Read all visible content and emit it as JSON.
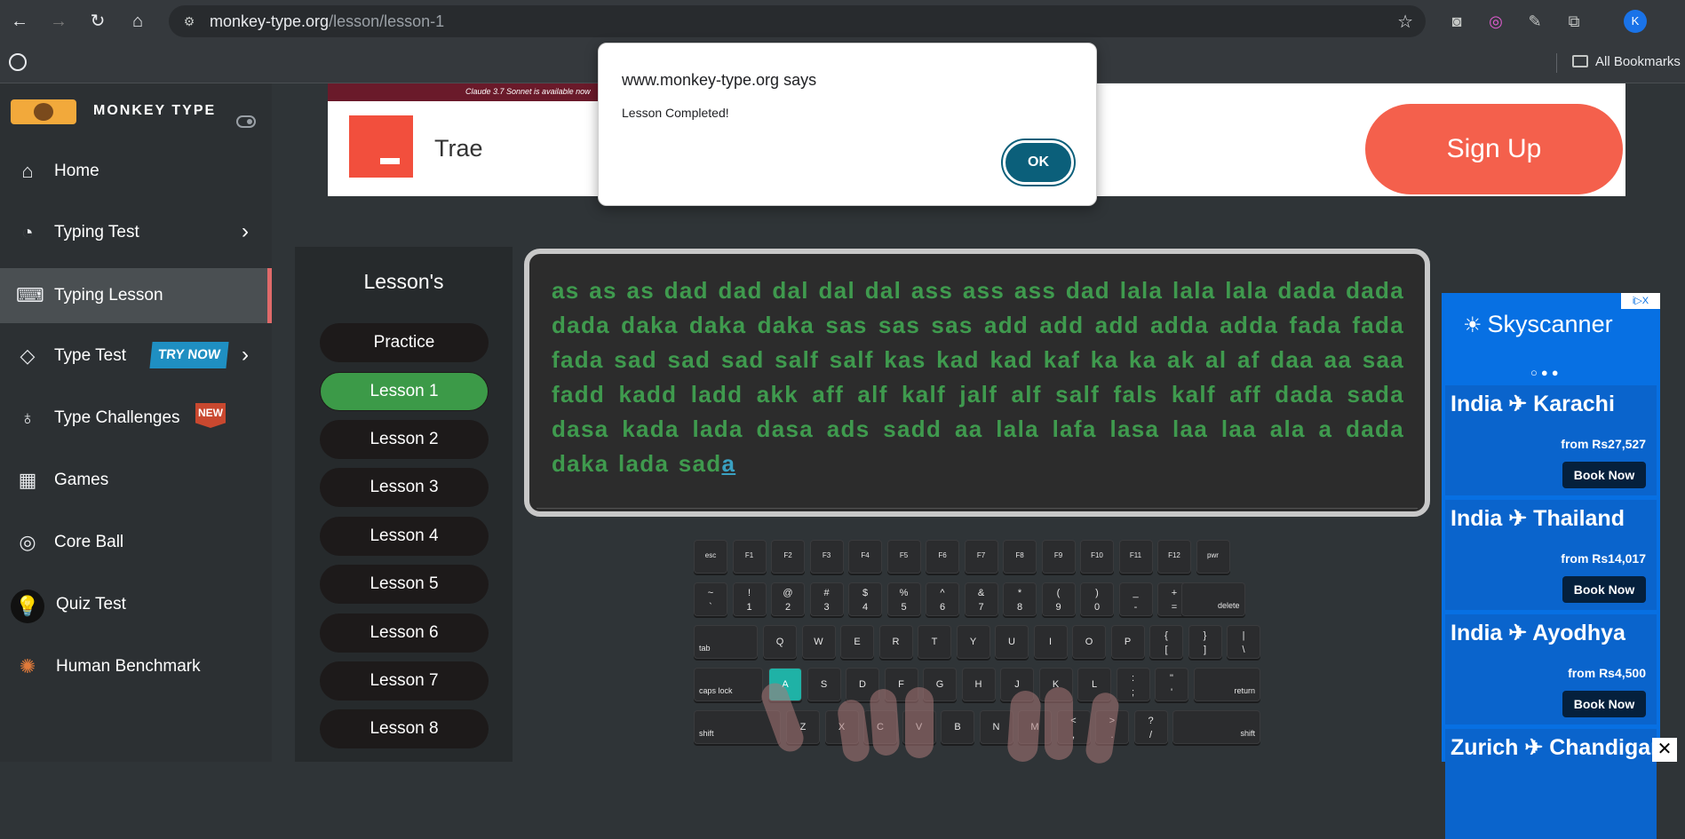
{
  "browser": {
    "url_host": "monkey-type.org",
    "url_path": "/lesson/lesson-1",
    "bookmarks_label": "All Bookmarks",
    "profile_initial": "K"
  },
  "dialog": {
    "title": "www.monkey-type.org says",
    "message": "Lesson Completed!",
    "ok_label": "OK"
  },
  "sidebar": {
    "brand": "MONKEY TYPE",
    "items": [
      {
        "label": "Home",
        "icon": "home-icon"
      },
      {
        "label": "Typing Test",
        "icon": "github-icon"
      },
      {
        "label": "Typing Lesson",
        "icon": "keyboard-icon"
      },
      {
        "label": "Type Test",
        "icon": "gitlab-icon",
        "badge": "TRY NOW"
      },
      {
        "label": "Type Challenges",
        "icon": "award-icon",
        "badge": "NEW"
      },
      {
        "label": "Games",
        "icon": "grid-icon"
      },
      {
        "label": "Core Ball",
        "icon": "target-icon"
      },
      {
        "label": "Quiz Test",
        "icon": "bulb-icon"
      },
      {
        "label": "Human Benchmark",
        "icon": "brain-icon"
      }
    ]
  },
  "ad_top": {
    "strip_text": "Claude 3.7 Sonnet  is available now",
    "brand": "Trae",
    "cta": "Sign Up"
  },
  "lessons": {
    "title": "Lesson's",
    "items": [
      "Practice",
      "Lesson 1",
      "Lesson 2",
      "Lesson 3",
      "Lesson 4",
      "Lesson 5",
      "Lesson 6",
      "Lesson 7",
      "Lesson 8"
    ],
    "active": "Lesson 1"
  },
  "typing": {
    "text": "as as as dad dad dal dal dal ass ass ass dad lala lala lala dada dada dada daka daka daka sas sas sas add add add adda adda fada fada fada sad sad sad salf salf kas kad kad kaf ka ka ak al af daa aa saa fadd kadd ladd akk aff alf kalf jalf alf salf fals kalf aff dada sada dasa kada lada dasa ads sadd aa lala lafa lasa laa laa ala a dada daka lada sad",
    "cursor_char": "a"
  },
  "keyboard": {
    "row0": [
      "esc",
      "F1",
      "F2",
      "F3",
      "F4",
      "F5",
      "F6",
      "F7",
      "F8",
      "F9",
      "F10",
      "F11",
      "F12",
      "pwr"
    ],
    "row1": [
      [
        "~",
        "`"
      ],
      [
        "!",
        "1"
      ],
      [
        "@",
        "2"
      ],
      [
        "#",
        "3"
      ],
      [
        "$",
        "4"
      ],
      [
        "%",
        "5"
      ],
      [
        "^",
        "6"
      ],
      [
        "&",
        "7"
      ],
      [
        "*",
        "8"
      ],
      [
        "(",
        "9"
      ],
      [
        ")",
        "0"
      ],
      [
        "_",
        "-"
      ],
      [
        "+",
        "="
      ]
    ],
    "row1_end": "delete",
    "row2_start": "tab",
    "row2": [
      "Q",
      "W",
      "E",
      "R",
      "T",
      "Y",
      "U",
      "I",
      "O",
      "P"
    ],
    "row2_sym": [
      [
        "{",
        "["
      ],
      [
        "}",
        "]"
      ],
      [
        "|",
        "\\"
      ]
    ],
    "row3_start": "caps lock",
    "row3": [
      "A",
      "S",
      "D",
      "F",
      "G",
      "H",
      "J",
      "K",
      "L"
    ],
    "row3_sym": [
      [
        ":",
        ";"
      ],
      [
        "\"",
        "'"
      ]
    ],
    "row3_end": "return",
    "row4_start": "shift",
    "row4": [
      "Z",
      "X",
      "C",
      "V",
      "B",
      "N",
      "M"
    ],
    "row4_sym": [
      [
        "<",
        ","
      ],
      [
        ">",
        "."
      ],
      [
        "?",
        "/"
      ]
    ],
    "row4_end": "shift",
    "highlight": "A"
  },
  "ad_right": {
    "adchoice": "i▷X",
    "brand": "Skyscanner",
    "deals": [
      {
        "title": "India ✈ Karachi",
        "price": "from Rs27,527",
        "cta": "Book Now"
      },
      {
        "title": "India ✈ Thailand",
        "price": "from Rs14,017",
        "cta": "Book Now"
      },
      {
        "title": "India ✈ Ayodhya",
        "price": "from Rs4,500",
        "cta": "Book Now"
      },
      {
        "title": "Zurich ✈ Chandigarh",
        "price": "",
        "cta": ""
      }
    ],
    "close": "✕"
  },
  "colors": {
    "accent_green": "#3c9a48",
    "text_green": "#3f9a4e",
    "dialog_ok": "#0b5f7a",
    "active_marker": "#e06a6a",
    "sky_blue": "#0770e3"
  }
}
